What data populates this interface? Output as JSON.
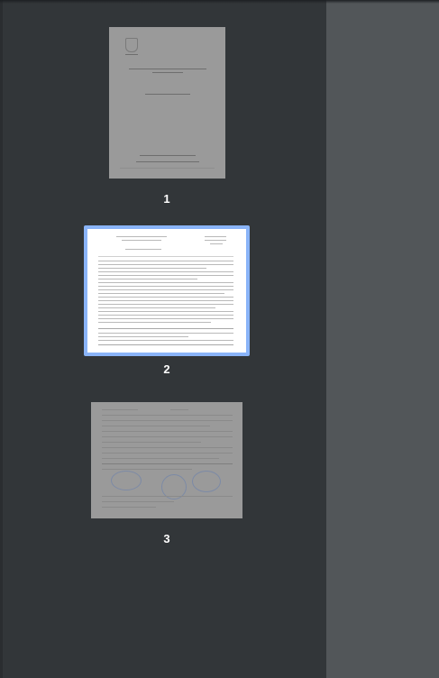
{
  "thumbnails": [
    {
      "page_number": "1",
      "selected": false
    },
    {
      "page_number": "2",
      "selected": true
    },
    {
      "page_number": "3",
      "selected": false
    }
  ],
  "colors": {
    "sidebar_bg": "#323639",
    "viewer_bg": "#525659",
    "selection_ring": "#8ab4f8",
    "unselected_page": "#9a9a9a",
    "selected_page": "#ffffff"
  }
}
